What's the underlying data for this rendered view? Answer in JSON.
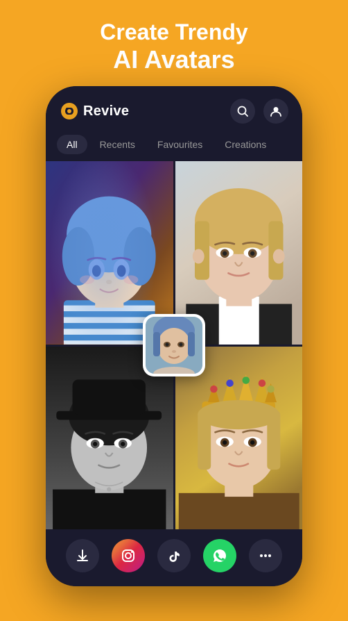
{
  "header": {
    "line1": "Create Trendy",
    "line2": "AI Avatars"
  },
  "app": {
    "name": "Revive"
  },
  "tabs": {
    "items": [
      {
        "id": "all",
        "label": "All",
        "active": true
      },
      {
        "id": "recents",
        "label": "Recents",
        "active": false
      },
      {
        "id": "favourites",
        "label": "Favourites",
        "active": false
      },
      {
        "id": "creations",
        "label": "Creations",
        "active": false
      }
    ]
  },
  "bottom_bar": {
    "buttons": [
      {
        "id": "download",
        "label": "↓"
      },
      {
        "id": "instagram",
        "label": "IG"
      },
      {
        "id": "tiktok",
        "label": "TT"
      },
      {
        "id": "whatsapp",
        "label": "WA"
      },
      {
        "id": "more",
        "label": "···"
      }
    ]
  },
  "icons": {
    "search": "🔍",
    "profile": "👤",
    "download": "⬇",
    "dots": "···"
  }
}
